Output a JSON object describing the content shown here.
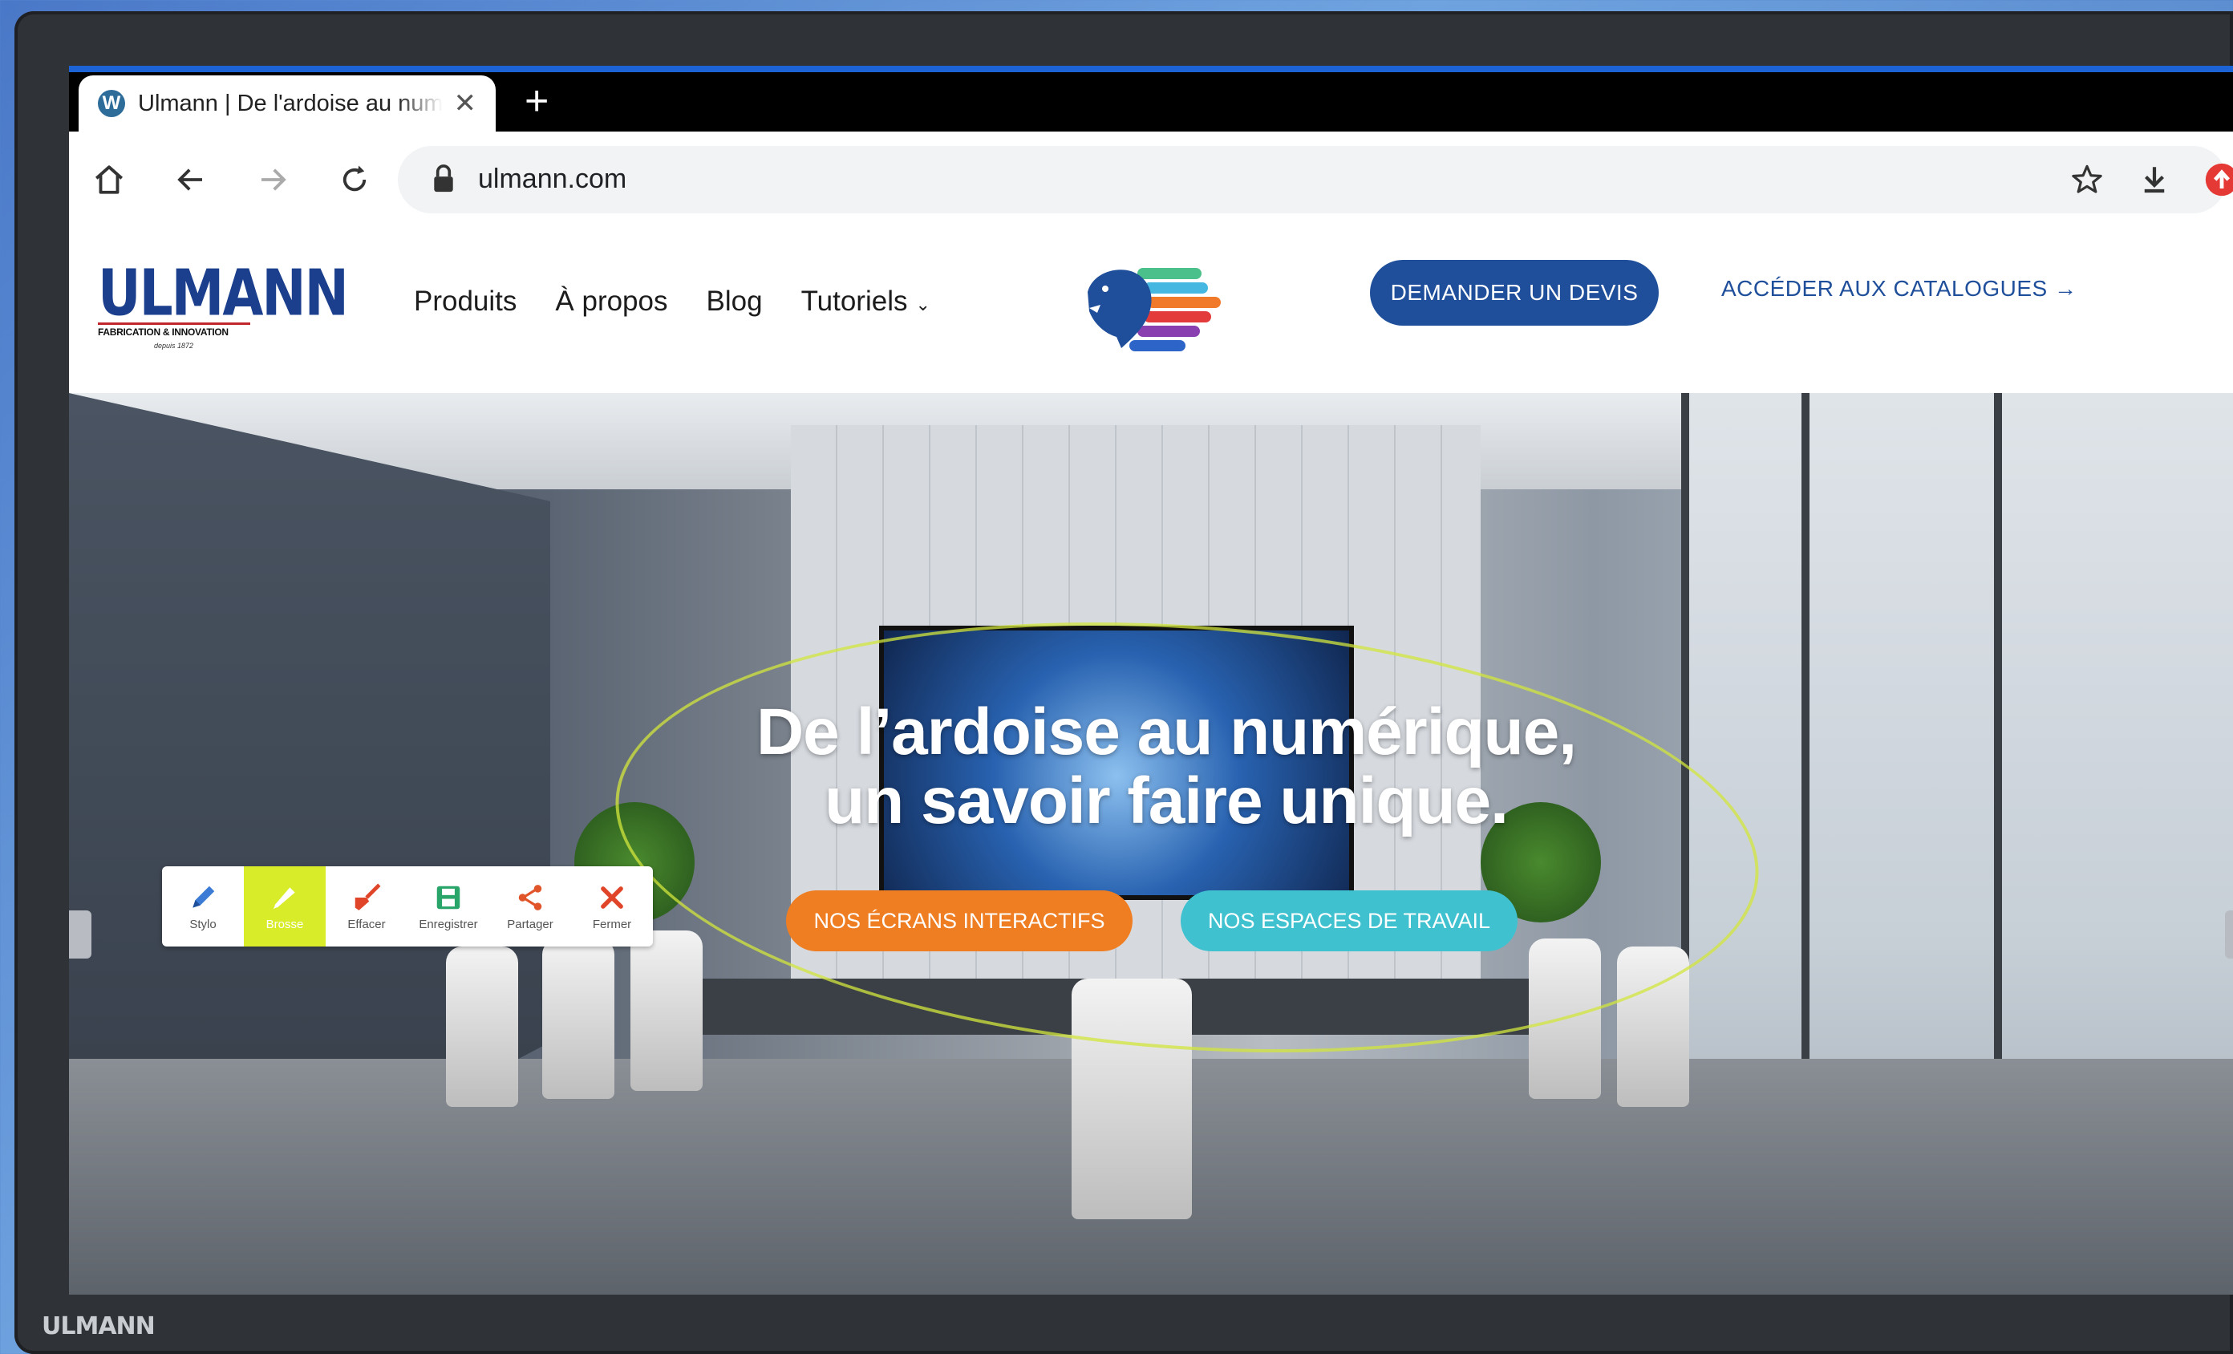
{
  "browser": {
    "tab_title": "Ulmann | De l'ardoise au numérique",
    "tab_favicon": "W",
    "new_tab_label": "+",
    "close_tab_label": "✕",
    "url": "ulmann.com"
  },
  "site": {
    "logo_text": "ULMANN",
    "logo_tagline": "FABRICATION & INNOVATION",
    "logo_since": "depuis 1872",
    "nav": {
      "produits": "Produits",
      "a_propos": "À propos",
      "blog": "Blog",
      "tutoriels": "Tutoriels"
    },
    "cta_devis": "DEMANDER UN DEVIS",
    "cta_catalogues": "ACCÉDER AUX CATALOGUES →"
  },
  "hero": {
    "title_line1": "De l’ardoise au numérique,",
    "title_line2": "un savoir faire unique.",
    "btn_ecrans": "NOS ÉCRANS INTERACTIFS",
    "btn_espaces": "NOS ESPACES DE TRAVAIL"
  },
  "annotation_toolbar": {
    "tools": [
      {
        "label": "Stylo",
        "icon": "pencil-icon",
        "color": "#3b7bd6"
      },
      {
        "label": "Brosse",
        "icon": "brush-icon",
        "color": "#ffffff"
      },
      {
        "label": "Effacer",
        "icon": "eraser-icon",
        "color": "#e0452a"
      },
      {
        "label": "Enregistrer",
        "icon": "save-icon",
        "color": "#2aa56a"
      },
      {
        "label": "Partager",
        "icon": "share-icon",
        "color": "#e0552a"
      },
      {
        "label": "Fermer",
        "icon": "close-icon",
        "color": "#e0452a"
      }
    ]
  },
  "bezel": {
    "brand": "ULMANN"
  },
  "colors": {
    "brand_blue": "#1f4f9a",
    "orange": "#ef7d22",
    "cyan": "#3fc1cf",
    "highlight": "#d8ec2a"
  }
}
